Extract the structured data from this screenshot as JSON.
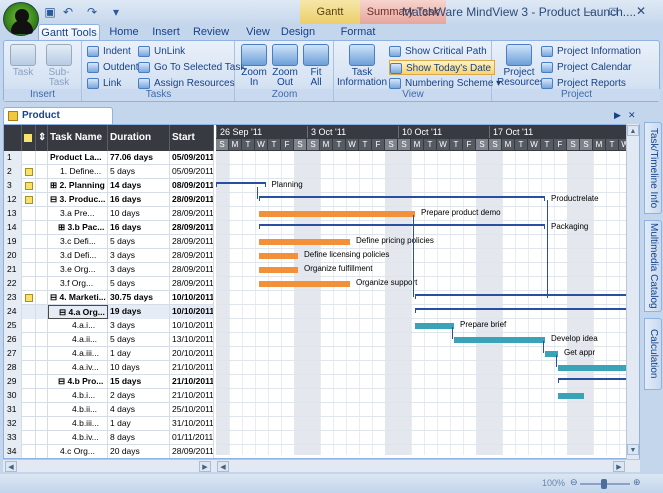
{
  "window": {
    "title": "MatchWare MindView 3 - Product Launch....",
    "min": "–",
    "max": "□",
    "close": "✕"
  },
  "context_tabs": {
    "gantt": "Gantt",
    "summary_task": "Summary Task"
  },
  "ribbon_tabs": [
    {
      "label": "Gantt Tools",
      "active": true
    },
    {
      "label": "Home"
    },
    {
      "label": "Insert"
    },
    {
      "label": "Review"
    },
    {
      "label": "View"
    },
    {
      "label": "Design"
    },
    {
      "label": "Format"
    }
  ],
  "groups": {
    "insert": {
      "label": "Insert",
      "task": "Task",
      "subtask": "Sub-Task"
    },
    "tasks": {
      "label": "Tasks",
      "indent": "Indent",
      "outdent": "Outdent",
      "link": "Link",
      "unlink": "UnLink",
      "goto": "Go To Selected Task",
      "assign": "Assign Resources"
    },
    "zoom": {
      "label": "Zoom",
      "zoom_in_1": "Zoom",
      "zoom_in_2": "In",
      "zoom_out_1": "Zoom",
      "zoom_out_2": "Out",
      "fit_1": "Fit",
      "fit_2": "All"
    },
    "view": {
      "label": "View",
      "task_info_1": "Task",
      "task_info_2": "Information",
      "critical": "Show Critical Path",
      "today": "Show Today's Date",
      "numbering": "Numbering Scheme"
    },
    "project": {
      "label": "Project",
      "resources_1": "Project",
      "resources_2": "Resources",
      "info": "Project Information",
      "calendar": "Project Calendar",
      "reports": "Project Reports"
    }
  },
  "doc_tab": "Product Launch.mvdx*",
  "side_tabs": [
    "Task/Timeline Info",
    "Multimedia Catalog",
    "Calculation"
  ],
  "columns": {
    "task": "Task Name",
    "duration": "Duration",
    "start": "Start"
  },
  "weeks": [
    "26 Sep '11",
    "3 Oct '11",
    "10 Oct '11",
    "17 Oct '11"
  ],
  "days": [
    "S",
    "M",
    "T",
    "W",
    "T",
    "F",
    "S",
    "S",
    "M",
    "T",
    "W",
    "T",
    "F",
    "S",
    "S",
    "M",
    "T",
    "W",
    "T",
    "F",
    "S",
    "S",
    "M",
    "T",
    "W",
    "T",
    "F",
    "S",
    "S",
    "M",
    "T",
    "W"
  ],
  "rows": [
    {
      "id": "1",
      "name": "Product La...",
      "dur": "77.06 days",
      "start": "05/09/2011",
      "bold": true,
      "note": false
    },
    {
      "id": "2",
      "name": "1. Define...",
      "dur": "5 days",
      "start": "05/09/2011",
      "bold": false,
      "note": true
    },
    {
      "id": "3",
      "name": "⊞ 2. Planning",
      "dur": "14 days",
      "start": "08/09/2011",
      "bold": true,
      "note": true
    },
    {
      "id": "12",
      "name": "⊟ 3. Produc...",
      "dur": "16 days",
      "start": "28/09/2011",
      "bold": true,
      "note": true
    },
    {
      "id": "13",
      "name": "3.a Pre...",
      "dur": "10 days",
      "start": "28/09/2011",
      "bold": false,
      "note": false
    },
    {
      "id": "14",
      "name": "⊞ 3.b Pac...",
      "dur": "16 days",
      "start": "28/09/2011",
      "bold": true,
      "note": false
    },
    {
      "id": "19",
      "name": "3.c Defi...",
      "dur": "5 days",
      "start": "28/09/2011",
      "bold": false,
      "note": false
    },
    {
      "id": "20",
      "name": "3.d Defi...",
      "dur": "3 days",
      "start": "28/09/2011",
      "bold": false,
      "note": false
    },
    {
      "id": "21",
      "name": "3.e Org...",
      "dur": "3 days",
      "start": "28/09/2011",
      "bold": false,
      "note": false
    },
    {
      "id": "22",
      "name": "3.f Org...",
      "dur": "5 days",
      "start": "28/09/2011",
      "bold": false,
      "note": false
    },
    {
      "id": "23",
      "name": "⊟ 4. Marketi...",
      "dur": "30.75 days",
      "start": "10/10/2011",
      "bold": true,
      "note": true
    },
    {
      "id": "24",
      "name": "⊟ 4.a Org...",
      "dur": "19 days",
      "start": "10/10/2011",
      "bold": true,
      "note": false,
      "selected": true
    },
    {
      "id": "25",
      "name": "4.a.i...",
      "dur": "3 days",
      "start": "10/10/2011",
      "bold": false,
      "note": false
    },
    {
      "id": "26",
      "name": "4.a.ii...",
      "dur": "5 days",
      "start": "13/10/2011",
      "bold": false,
      "note": false
    },
    {
      "id": "27",
      "name": "4.a.iii...",
      "dur": "1 day",
      "start": "20/10/2011",
      "bold": false,
      "note": false
    },
    {
      "id": "28",
      "name": "4.a.iv...",
      "dur": "10 days",
      "start": "21/10/2011",
      "bold": false,
      "note": false
    },
    {
      "id": "29",
      "name": "⊟ 4.b Pro...",
      "dur": "15 days",
      "start": "21/10/2011",
      "bold": true,
      "note": false
    },
    {
      "id": "30",
      "name": "4.b.i...",
      "dur": "2 days",
      "start": "21/10/2011",
      "bold": false,
      "note": false
    },
    {
      "id": "31",
      "name": "4.b.ii...",
      "dur": "4 days",
      "start": "25/10/2011",
      "bold": false,
      "note": false
    },
    {
      "id": "32",
      "name": "4.b.iii...",
      "dur": "1 day",
      "start": "31/10/2011",
      "bold": false,
      "note": false
    },
    {
      "id": "33",
      "name": "4.b.iv...",
      "dur": "8 days",
      "start": "01/11/2011",
      "bold": false,
      "note": false
    },
    {
      "id": "34",
      "name": "4.c Org...",
      "dur": "20 days",
      "start": "28/09/2011",
      "bold": false,
      "note": false
    }
  ],
  "bars": [
    {
      "row": 2,
      "kind": "summary",
      "start": -1,
      "end": 3.5,
      "label": "Planning"
    },
    {
      "row": 3,
      "kind": "summary",
      "start": 3,
      "end": 25,
      "label": "Productrelate"
    },
    {
      "row": 4,
      "kind": "task",
      "color": "orange",
      "start": 3,
      "end": 15,
      "label": "Prepare product demo"
    },
    {
      "row": 5,
      "kind": "summary",
      "start": 3,
      "end": 25,
      "label": "Packaging"
    },
    {
      "row": 6,
      "kind": "task",
      "color": "orange",
      "start": 3,
      "end": 10,
      "label": "Define pricing policies"
    },
    {
      "row": 7,
      "kind": "task",
      "color": "orange",
      "start": 3,
      "end": 6,
      "label": "Define licensing policies"
    },
    {
      "row": 8,
      "kind": "task",
      "color": "orange",
      "start": 3,
      "end": 6,
      "label": "Organize fulfillment"
    },
    {
      "row": 9,
      "kind": "task",
      "color": "orange",
      "start": 3,
      "end": 10,
      "label": "Organize support"
    },
    {
      "row": 10,
      "kind": "summary",
      "start": 15,
      "end": 33,
      "label": ""
    },
    {
      "row": 11,
      "kind": "summary",
      "start": 15,
      "end": 33,
      "label": ""
    },
    {
      "row": 12,
      "kind": "task",
      "color": "teal",
      "start": 15,
      "end": 18,
      "label": "Prepare brief"
    },
    {
      "row": 13,
      "kind": "task",
      "color": "teal",
      "start": 18,
      "end": 25,
      "label": "Develop idea"
    },
    {
      "row": 14,
      "kind": "task",
      "color": "teal",
      "start": 25,
      "end": 26,
      "label": "Get appr"
    },
    {
      "row": 15,
      "kind": "task",
      "color": "teal",
      "start": 26,
      "end": 33,
      "label": ""
    },
    {
      "row": 16,
      "kind": "summary",
      "start": 26,
      "end": 33,
      "label": ""
    },
    {
      "row": 17,
      "kind": "task",
      "color": "teal",
      "start": 26,
      "end": 28,
      "label": ""
    }
  ],
  "status": {
    "zoom": "100%"
  }
}
